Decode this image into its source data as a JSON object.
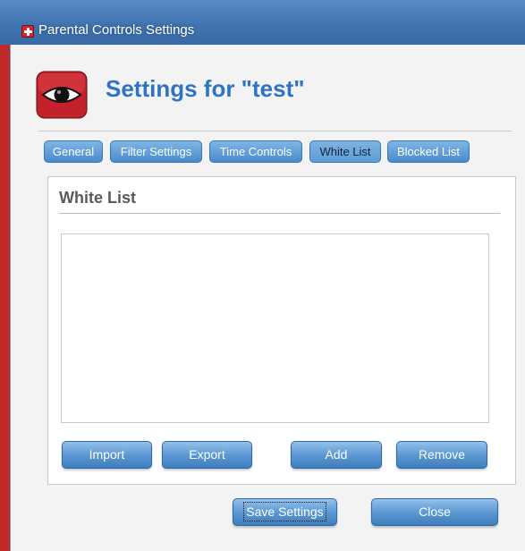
{
  "window": {
    "title": "Parental Controls Settings"
  },
  "header": {
    "title": "Settings for \"test\"",
    "logo_icon": "eye-icon"
  },
  "tabs": [
    {
      "label": "General",
      "active": false
    },
    {
      "label": "Filter Settings",
      "active": false
    },
    {
      "label": "Time Controls",
      "active": false
    },
    {
      "label": "White List",
      "active": true
    },
    {
      "label": "Blocked List",
      "active": false
    }
  ],
  "panel": {
    "title": "White List",
    "entries": []
  },
  "panel_buttons": {
    "import": "Import",
    "export": "Export",
    "add": "Add",
    "remove": "Remove"
  },
  "footer_buttons": {
    "save": "Save Settings",
    "close": "Close"
  },
  "colors": {
    "window_frame": "#c0282a",
    "titlebar": "#3e72b0",
    "header_title": "#2f74c4",
    "button": "#5d99d3"
  }
}
